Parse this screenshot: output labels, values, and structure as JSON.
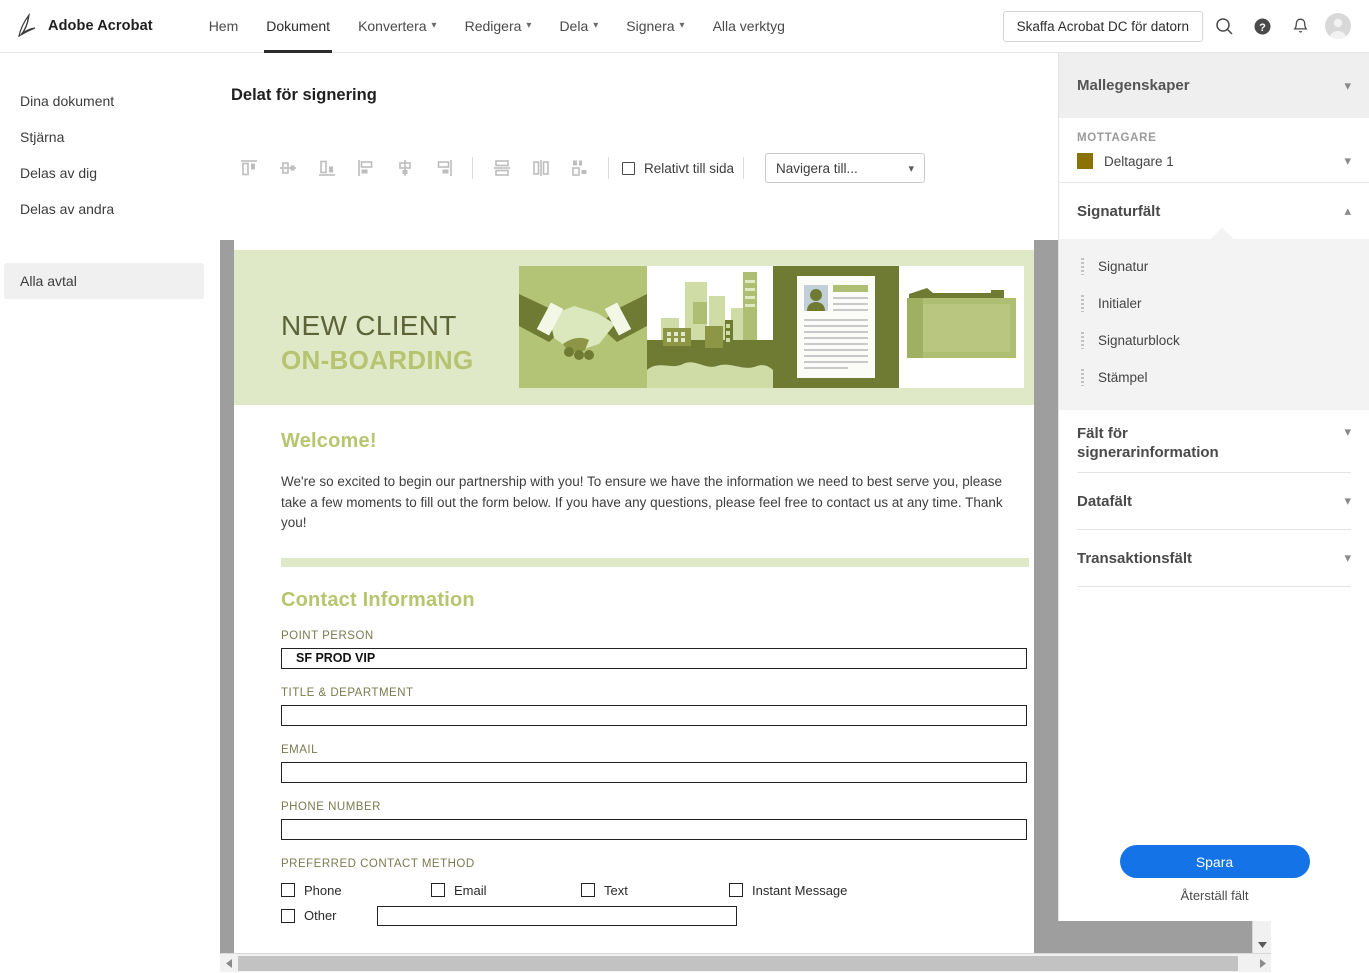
{
  "header": {
    "brand": "Adobe Acrobat",
    "logo_icon": "adobe-acrobat-logo",
    "nav": [
      {
        "label": "Hem",
        "dropdown": false,
        "active": false
      },
      {
        "label": "Dokument",
        "dropdown": false,
        "active": true
      },
      {
        "label": "Konvertera",
        "dropdown": true,
        "active": false
      },
      {
        "label": "Redigera",
        "dropdown": true,
        "active": false
      },
      {
        "label": "Dela",
        "dropdown": true,
        "active": false
      },
      {
        "label": "Signera",
        "dropdown": true,
        "active": false
      },
      {
        "label": "Alla verktyg",
        "dropdown": false,
        "active": false
      }
    ],
    "cta_label": "Skaffa Acrobat DC för datorn",
    "icons": [
      "search-icon",
      "help-icon",
      "notification-bell-icon",
      "avatar"
    ]
  },
  "sidebar": {
    "items": [
      {
        "label": "Dina dokument",
        "selected": false
      },
      {
        "label": "Stjärna",
        "selected": false
      },
      {
        "label": "Delas av dig",
        "selected": false
      },
      {
        "label": "Delas av andra",
        "selected": false
      }
    ],
    "bottom_items": [
      {
        "label": "Alla avtal",
        "selected": true
      }
    ]
  },
  "main": {
    "page_title": "Delat för signering",
    "toolbar": {
      "align_buttons": [
        "align-top-icon",
        "align-vertical-center-icon",
        "align-bottom-icon",
        "align-left-icon",
        "align-horizontal-center-icon",
        "align-right-icon"
      ],
      "distribute_buttons": [
        "distribute-vertical-icon",
        "distribute-horizontal-icon",
        "match-size-icon"
      ],
      "relative_checkbox_label": "Relativt till sida",
      "relative_checkbox_checked": false,
      "navigate_select_value": "Navigera till..."
    }
  },
  "document": {
    "banner": {
      "title_line1": "NEW CLIENT",
      "title_line2": "ON-BOARDING",
      "images": [
        "handshake-illustration",
        "cityscape-illustration",
        "resume-document-illustration",
        "folder-illustration"
      ],
      "bg_color": "#dfe9c8"
    },
    "welcome_heading": "Welcome!",
    "intro_paragraph": "We're so excited to begin our partnership with you! To ensure we have the information we need to best serve you, please take a few moments to fill out the form below. If you have any questions, please feel free to contact us at any time. Thank you!",
    "section_heading": "Contact Information",
    "fields": [
      {
        "label": "POINT PERSON",
        "value": "SF PROD VIP"
      },
      {
        "label": "TITLE & DEPARTMENT",
        "value": ""
      },
      {
        "label": "EMAIL",
        "value": ""
      },
      {
        "label": "PHONE NUMBER",
        "value": ""
      }
    ],
    "contact_method": {
      "label": "PREFERRED CONTACT METHOD",
      "options": [
        {
          "label": "Phone",
          "checked": false
        },
        {
          "label": "Email",
          "checked": false
        },
        {
          "label": "Text",
          "checked": false
        },
        {
          "label": "Instant Message",
          "checked": false
        }
      ],
      "other_label": "Other",
      "other_value": ""
    },
    "heading_color": "#b7c56f"
  },
  "right_panel": {
    "header_title": "Mallegenskaper",
    "recipient_label": "MOTTAGARE",
    "recipient_name": "Deltagare 1",
    "recipient_color": "#8a7304",
    "sections": [
      {
        "title": "Signaturfält",
        "expanded": true
      },
      {
        "title": "Fält för signerarinformation",
        "expanded": false
      },
      {
        "title": "Datafält",
        "expanded": false
      },
      {
        "title": "Transaktionsfält",
        "expanded": false
      }
    ],
    "signature_fields": [
      {
        "label": "Signatur"
      },
      {
        "label": "Initialer"
      },
      {
        "label": "Signaturblock"
      },
      {
        "label": "Stämpel"
      }
    ],
    "save_label": "Spara",
    "reset_label": "Återställ fält",
    "save_color": "#1473e6"
  }
}
